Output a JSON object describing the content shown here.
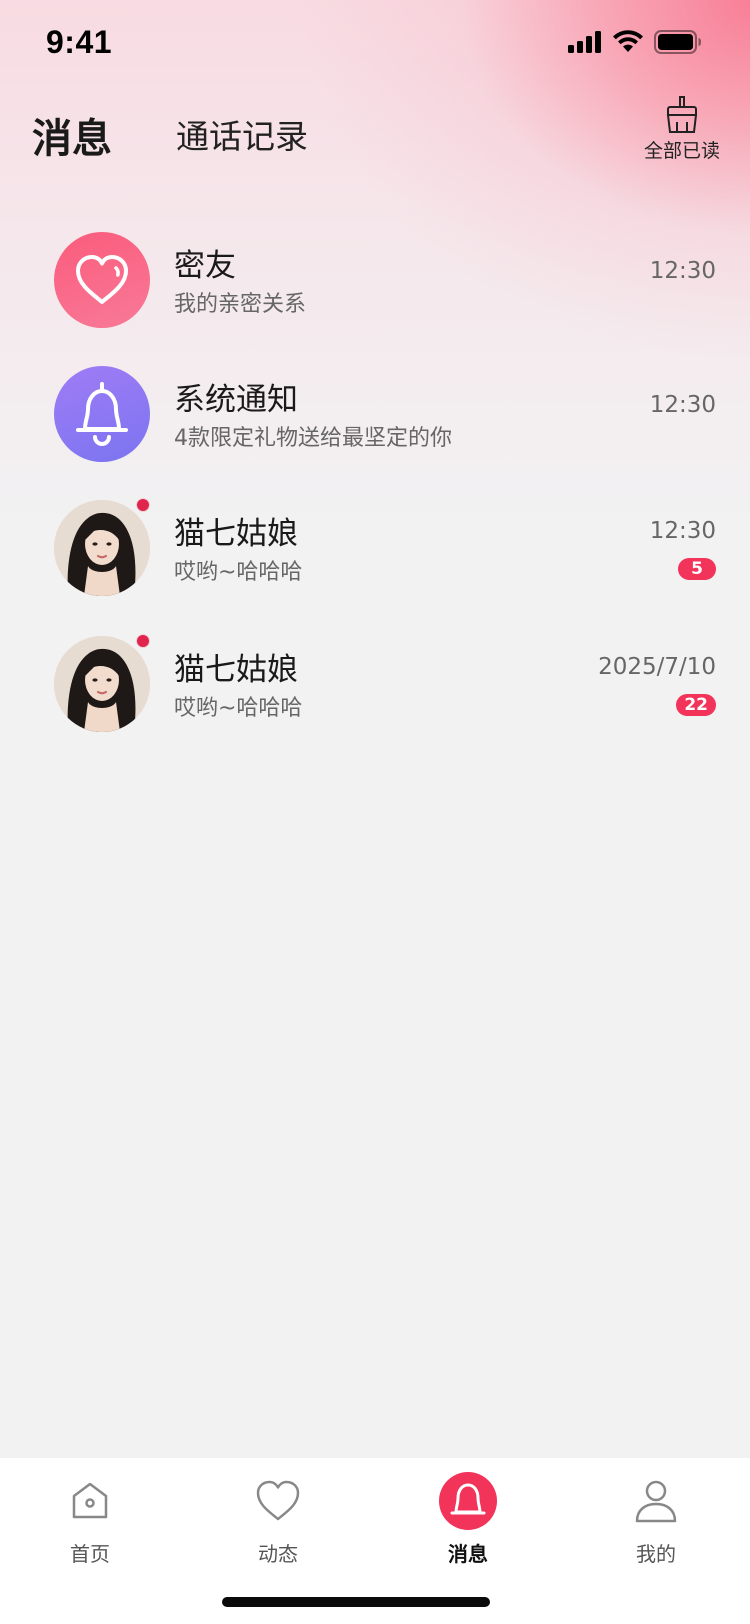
{
  "status_bar": {
    "time": "9:41",
    "icons": [
      "signal-icon",
      "wifi-icon",
      "battery-icon"
    ]
  },
  "header": {
    "tab_active": "消息",
    "tab_inactive": "通话记录",
    "read_all_label": "全部已读",
    "read_all_icon": "broom-icon"
  },
  "messages": [
    {
      "name": "密友",
      "preview": "我的亲密关系",
      "time": "12:30",
      "badge": "",
      "avatar": "heart-icon",
      "unread_dot": false
    },
    {
      "name": "系统通知",
      "preview": "4款限定礼物送给最坚定的你",
      "time": "12:30",
      "badge": "",
      "avatar": "bell-icon",
      "unread_dot": false
    },
    {
      "name": "猫七姑娘",
      "preview": "哎哟~哈哈哈",
      "time": "12:30",
      "badge": "5",
      "avatar": "user-photo",
      "unread_dot": true
    },
    {
      "name": "猫七姑娘",
      "preview": "哎哟~哈哈哈",
      "time": "2025/7/10",
      "badge": "22",
      "avatar": "user-photo",
      "unread_dot": true
    }
  ],
  "tab_bar": {
    "items": [
      {
        "label": "首页",
        "icon": "home-icon",
        "active": false
      },
      {
        "label": "动态",
        "icon": "heart-outline-icon",
        "active": false
      },
      {
        "label": "消息",
        "icon": "bell-icon",
        "active": true
      },
      {
        "label": "我的",
        "icon": "profile-icon",
        "active": false
      }
    ]
  },
  "colors": {
    "accent": "#f2335a",
    "heart_avatar": "#fb5b7c",
    "bell_avatar": "#8f79f3",
    "unread_dot": "#e0254d"
  }
}
